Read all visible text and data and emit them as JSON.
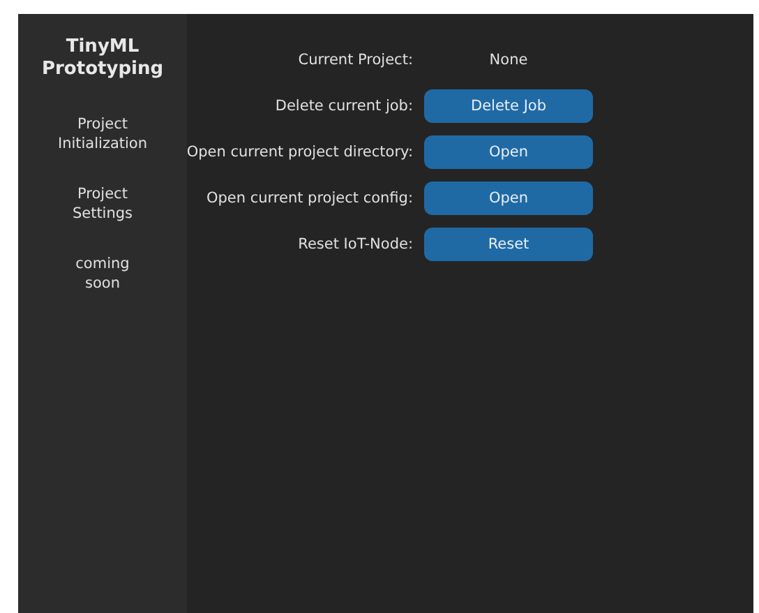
{
  "sidebar": {
    "title": "TinyML\nPrototyping",
    "items": [
      {
        "label": "Project\nInitialization"
      },
      {
        "label": "Project\nSettings"
      },
      {
        "label": "coming\nsoon"
      }
    ]
  },
  "current_project": {
    "label": "Current Project:",
    "value": "None"
  },
  "actions": [
    {
      "label": "Delete current job:",
      "button": "Delete Job"
    },
    {
      "label": "Open current project directory:",
      "button": "Open"
    },
    {
      "label": "Open current project config:",
      "button": "Open"
    },
    {
      "label": "Reset IoT-Node:",
      "button": "Reset"
    }
  ]
}
